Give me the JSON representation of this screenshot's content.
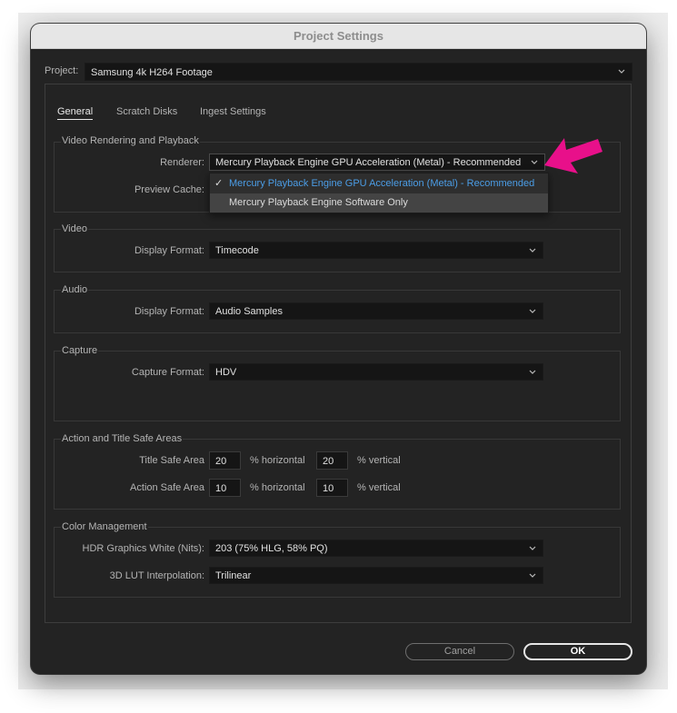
{
  "dialog": {
    "title": "Project Settings",
    "project_label": "Project:",
    "project_value": "Samsung 4k H264 Footage",
    "tabs": [
      {
        "label": "General",
        "active": true
      },
      {
        "label": "Scratch Disks",
        "active": false
      },
      {
        "label": "Ingest Settings",
        "active": false
      }
    ],
    "sections": {
      "video_rendering": {
        "title": "Video Rendering and Playback",
        "renderer_label": "Renderer:",
        "renderer_value": "Mercury Playback Engine GPU Acceleration (Metal) - Recommended",
        "preview_cache_label": "Preview Cache:"
      },
      "video": {
        "title": "Video",
        "display_format_label": "Display Format:",
        "display_format_value": "Timecode"
      },
      "audio": {
        "title": "Audio",
        "display_format_label": "Display Format:",
        "display_format_value": "Audio Samples"
      },
      "capture": {
        "title": "Capture",
        "capture_format_label": "Capture Format:",
        "capture_format_value": "HDV"
      },
      "safe_areas": {
        "title": "Action and Title Safe Areas",
        "title_safe_label": "Title Safe Area",
        "title_safe_h": "20",
        "title_safe_v": "20",
        "action_safe_label": "Action Safe Area",
        "action_safe_h": "10",
        "action_safe_v": "10",
        "horizontal_unit": "% horizontal",
        "vertical_unit": "% vertical"
      },
      "color_management": {
        "title": "Color Management",
        "hdr_label": "HDR Graphics White (Nits):",
        "hdr_value": "203 (75% HLG, 58% PQ)",
        "lut_label": "3D LUT Interpolation:",
        "lut_value": "Trilinear"
      }
    },
    "renderer_dropdown": {
      "options": [
        {
          "label": "Mercury Playback Engine GPU Acceleration (Metal) - Recommended",
          "selected": true
        },
        {
          "label": "Mercury Playback Engine Software Only",
          "selected": false
        }
      ]
    },
    "buttons": {
      "cancel": "Cancel",
      "ok": "OK"
    }
  },
  "colors": {
    "window_bg": "#232323",
    "selected_option": "#4b9de6",
    "annotation_arrow": "#e8108a"
  },
  "icons": {
    "dropdown": "chevron-down-icon",
    "checkmark": "check-icon",
    "annotation": "arrow-icon"
  }
}
